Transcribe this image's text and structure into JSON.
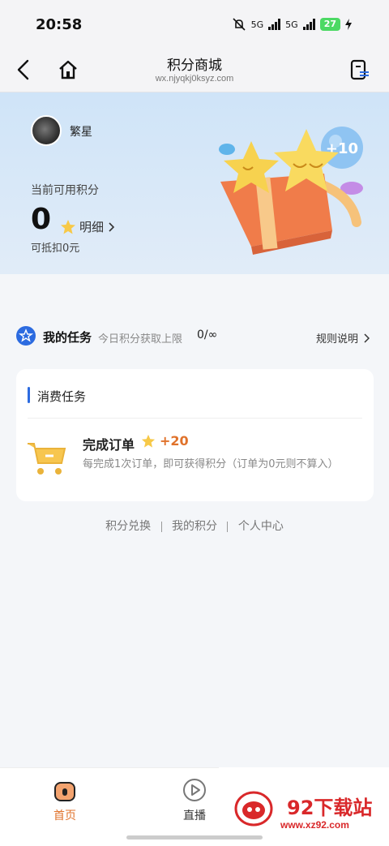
{
  "status_bar": {
    "time": "20:58",
    "net1": "5G",
    "net2": "5G",
    "battery": "27"
  },
  "nav": {
    "title": "积分商城",
    "url": "wx.njyqkj0ksyz.com"
  },
  "hero": {
    "username": "繁星",
    "points_label": "当前可用积分",
    "points_value": "0",
    "detail_label": "明细",
    "deduct_text": "可抵扣0元",
    "bubble_text": "+10"
  },
  "tasks": {
    "title": "我的任务",
    "limit_label": "今日积分获取上限",
    "limit_value": "0/∞",
    "rules_label": "规则说明"
  },
  "consume_card": {
    "title": "消费任务",
    "order_title": "完成订单",
    "order_bonus": "+20",
    "order_desc": "每完成1次订单，即可获得积分（订单为0元则不算入）"
  },
  "footer_links": [
    "积分兑换",
    "我的积分",
    "个人中心"
  ],
  "bottom_nav": {
    "home_label": "首页",
    "live_label": "直播"
  },
  "watermark": {
    "text": "92下载站",
    "url": "www.xz92.com"
  },
  "colors": {
    "accent_orange": "#e0722b",
    "accent_blue": "#2c6be0",
    "hero_bg": "#cfe4f8"
  }
}
